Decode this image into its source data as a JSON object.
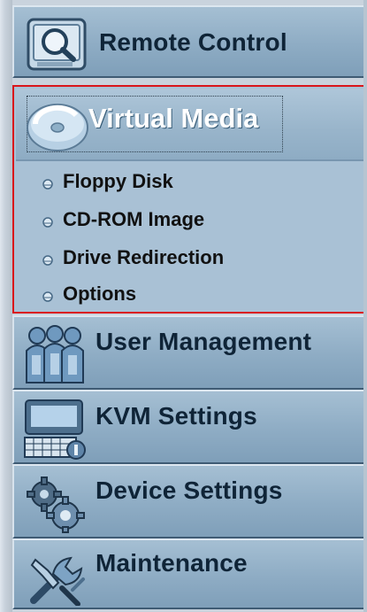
{
  "menu": {
    "remote_control": {
      "label": "Remote Control",
      "icon": "magnifier-screen-icon"
    },
    "virtual_media": {
      "label": "Virtual Media",
      "icon": "disc-icon",
      "items": [
        {
          "label": "Floppy Disk"
        },
        {
          "label": "CD-ROM Image"
        },
        {
          "label": "Drive Redirection"
        },
        {
          "label": "Options"
        }
      ]
    },
    "user_management": {
      "label": "User Management",
      "icon": "users-icon"
    },
    "kvm_settings": {
      "label": "KVM Settings",
      "icon": "monitor-keyboard-icon"
    },
    "device_settings": {
      "label": "Device Settings",
      "icon": "gears-icon"
    },
    "maintenance": {
      "label": "Maintenance",
      "icon": "tools-icon"
    }
  },
  "colors": {
    "menu_background": "#8eacc4",
    "active_border": "#d9161b",
    "active_label": "#ffffff",
    "label_text": "#0f2437"
  }
}
